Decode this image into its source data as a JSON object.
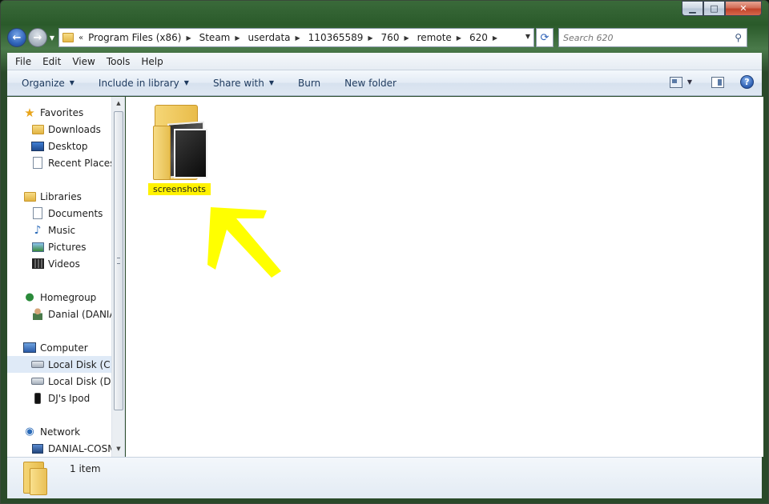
{
  "window": {
    "caption": {
      "minimize": "▁",
      "maximize": "□",
      "close": "✕"
    }
  },
  "address": {
    "chevron": "«",
    "crumbs": [
      "Program Files (x86)",
      "Steam",
      "userdata",
      "110365589",
      "760",
      "remote",
      "620"
    ],
    "dropdown": "▼"
  },
  "search": {
    "placeholder": "Search 620"
  },
  "menu": {
    "file": "File",
    "edit": "Edit",
    "view": "View",
    "tools": "Tools",
    "help": "Help"
  },
  "commands": {
    "organize": "Organize",
    "include_in_library": "Include in library",
    "share_with": "Share with",
    "burn": "Burn",
    "new_folder": "New folder",
    "help": "?"
  },
  "nav": {
    "favorites": {
      "label": "Favorites",
      "items": [
        "Downloads",
        "Desktop",
        "Recent Places"
      ]
    },
    "libraries": {
      "label": "Libraries",
      "items": [
        "Documents",
        "Music",
        "Pictures",
        "Videos"
      ]
    },
    "homegroup": {
      "label": "Homegroup",
      "items": [
        "Danial (DANIAL"
      ]
    },
    "computer": {
      "label": "Computer",
      "items": [
        "Local Disk (C:)",
        "Local Disk (D:)",
        "DJ's Ipod"
      ]
    },
    "network": {
      "label": "Network",
      "items": [
        "DANIAL-COSM"
      ]
    }
  },
  "content": {
    "items": [
      {
        "name": "screenshots",
        "type": "folder"
      }
    ]
  },
  "details": {
    "item_count": "1 item"
  },
  "icons": {
    "back": "back-arrow-icon",
    "forward": "forward-arrow-icon",
    "refresh": "refresh-icon",
    "search": "search-icon",
    "views": "change-view-icon",
    "preview_pane": "preview-pane-icon",
    "help": "help-icon",
    "annotation": "yellow-arrow-annotation"
  },
  "colors": {
    "highlight": "#fff200",
    "selected_nav": "#dfeaf7",
    "accent": "#1e3a5e"
  }
}
